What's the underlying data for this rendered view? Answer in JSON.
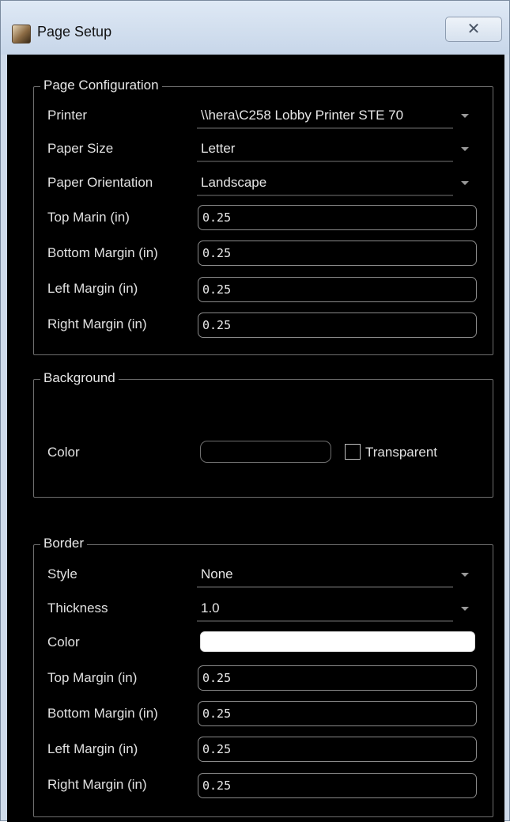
{
  "window": {
    "title": "Page Setup",
    "close_label": "✕"
  },
  "page_configuration": {
    "legend": "Page Configuration",
    "printer": {
      "label": "Printer",
      "value": "\\\\hera\\C258 Lobby Printer STE 70"
    },
    "paper_size": {
      "label": "Paper Size",
      "value": "Letter"
    },
    "paper_orientation": {
      "label": "Paper Orientation",
      "value": "Landscape"
    },
    "top_margin": {
      "label": "Top Marin (in)",
      "value": "0.25"
    },
    "bottom_margin": {
      "label": "Bottom Margin (in)",
      "value": "0.25"
    },
    "left_margin": {
      "label": "Left Margin (in)",
      "value": "0.25"
    },
    "right_margin": {
      "label": "Right Margin (in)",
      "value": "0.25"
    }
  },
  "background": {
    "legend": "Background",
    "color_label": "Color",
    "color_value": "#000000",
    "transparent_label": "Transparent",
    "transparent_checked": false
  },
  "border": {
    "legend": "Border",
    "style": {
      "label": "Style",
      "value": "None"
    },
    "thickness": {
      "label": "Thickness",
      "value": "1.0"
    },
    "color_label": "Color",
    "color_value": "#ffffff",
    "top_margin": {
      "label": "Top Margin (in)",
      "value": "0.25"
    },
    "bottom_margin": {
      "label": "Bottom Margin (in)",
      "value": "0.25"
    },
    "left_margin": {
      "label": "Left Margin (in)",
      "value": "0.25"
    },
    "right_margin": {
      "label": "Right Margin (in)",
      "value": "0.25"
    }
  },
  "icons": {
    "app": "page-setup-app-icon",
    "close": "close-icon",
    "dropdown": "chevron-down-icon"
  }
}
